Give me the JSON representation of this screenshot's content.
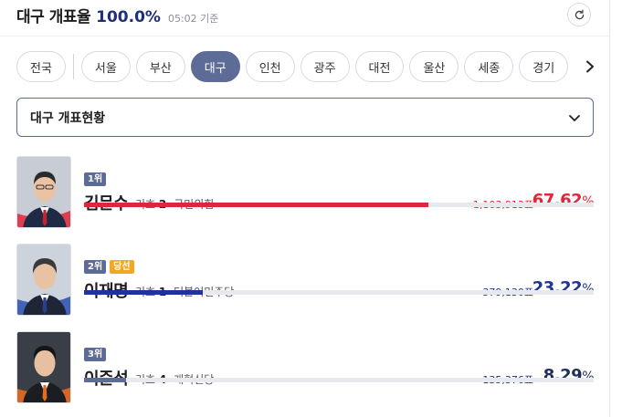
{
  "header": {
    "title": "대구 개표율",
    "rate": "100.0",
    "rate_unit": "%",
    "time": "05:02 기준"
  },
  "tabs": [
    {
      "label": "전국",
      "active": false
    },
    {
      "label": "서울",
      "active": false
    },
    {
      "label": "부산",
      "active": false
    },
    {
      "label": "대구",
      "active": true
    },
    {
      "label": "인천",
      "active": false
    },
    {
      "label": "광주",
      "active": false
    },
    {
      "label": "대전",
      "active": false
    },
    {
      "label": "울산",
      "active": false
    },
    {
      "label": "세종",
      "active": false
    },
    {
      "label": "경기",
      "active": false
    }
  ],
  "select": {
    "label": "대구 개표현황"
  },
  "candidates": [
    {
      "rank": "1위",
      "won": "",
      "name": "김문수",
      "giho_label": "기호",
      "giho_num": "2",
      "party": "국민의힘",
      "votes": "1,103,913표",
      "pct": "67.62",
      "pct_unit": "%",
      "share": 0.6762,
      "color": "#e0263a",
      "photo_bg": "#c8cdd5",
      "suit": "#1f2a44",
      "tie": "#c4242f"
    },
    {
      "rank": "2위",
      "won": "당선",
      "name": "이재명",
      "giho_label": "기호",
      "giho_num": "1",
      "party": "더불어민주당",
      "votes": "379,130표",
      "pct": "23.22",
      "pct_unit": "%",
      "share": 0.2322,
      "color": "#1f3494",
      "photo_bg": "#cdd3dc",
      "suit": "#1d2536",
      "tie": "#2a3f8a"
    },
    {
      "rank": "3위",
      "won": "",
      "name": "이준석",
      "giho_label": "기호",
      "giho_num": "4",
      "party": "개혁신당",
      "votes": "135,376표",
      "pct": "8.29",
      "pct_unit": "%",
      "share": 0.0829,
      "color": "#5d6c97",
      "photo_bg": "#3a3f47",
      "suit": "#1a1d22",
      "tie": "#e86a1f"
    }
  ]
}
